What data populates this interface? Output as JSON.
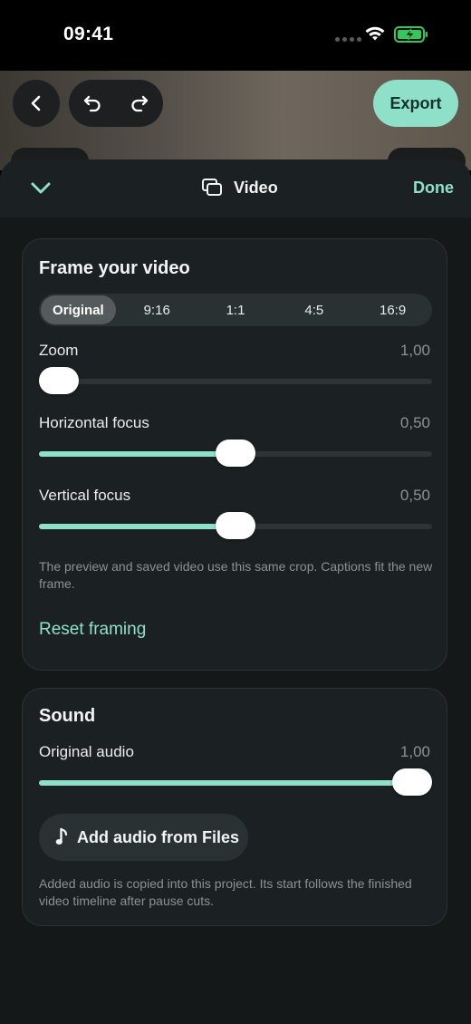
{
  "status_bar": {
    "time": "09:41"
  },
  "top_bar": {
    "export_label": "Export"
  },
  "sheet": {
    "title": "Video",
    "done_label": "Done"
  },
  "framing": {
    "title": "Frame your video",
    "aspect_options": [
      "Original",
      "9:16",
      "1:1",
      "4:5",
      "16:9"
    ],
    "selected_aspect": "Original",
    "zoom": {
      "label": "Zoom",
      "value_text": "1,00",
      "fraction": 0.0
    },
    "horizontal_focus": {
      "label": "Horizontal focus",
      "value_text": "0,50",
      "fraction": 0.5
    },
    "vertical_focus": {
      "label": "Vertical focus",
      "value_text": "0,50",
      "fraction": 0.5
    },
    "caption": "The preview and saved video use this same crop. Captions fit the new frame.",
    "reset_label": "Reset framing"
  },
  "sound": {
    "title": "Sound",
    "original_audio": {
      "label": "Original audio",
      "value_text": "1,00",
      "fraction": 1.0
    },
    "add_audio_label": "Add audio from Files",
    "caption": "Added audio is copied into this project. Its start follows the finished video timeline after pause cuts."
  },
  "colors": {
    "accent": "#8fe0c8",
    "sheet_bg": "#141819",
    "card_bg": "#1b2123",
    "battery": "#34c759"
  },
  "icons": {
    "back": "chevron-left-icon",
    "undo": "undo-icon",
    "redo": "redo-icon",
    "collapse": "chevron-down-icon",
    "video": "video-layers-icon",
    "music": "music-note-icon",
    "wifi": "wifi-icon",
    "battery": "battery-charging-icon",
    "signal": "signal-dots-icon"
  }
}
